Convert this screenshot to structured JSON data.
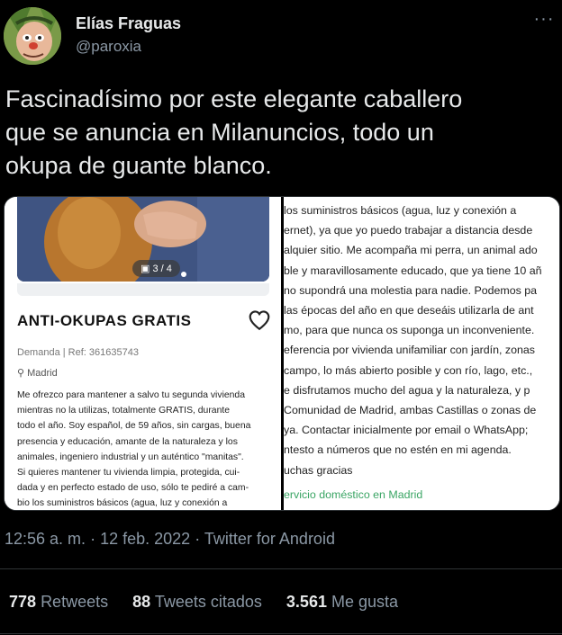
{
  "author": {
    "name": "Elías Fraguas",
    "handle": "@paroxia"
  },
  "more_menu_icon": "ellipsis-icon",
  "tweet": {
    "text_lines": [
      "Fascinadísimo por este elegante caballero",
      "que se anuncia en Milanuncios, todo un",
      "okupa de guante blanco."
    ]
  },
  "ad": {
    "photo_counter": "3 / 4",
    "title": "ANTI-OKUPAS GRATIS",
    "ref": "Demanda | Ref: 361635743",
    "location": "Madrid",
    "body_lines": [
      "Me ofrezco para mantener a salvo tu segunda vivienda",
      "mientras no la utilizas, totalmente GRATIS, durante",
      "todo el año. Soy español, de 59 años, sin cargas, buena",
      "presencia y educación, amante de la naturaleza y los",
      "animales, ingeniero industrial y un auténtico \"manitas\".",
      "Si quieres mantener tu vivienda limpia, protegida, cui-",
      "dada y en perfecto estado de uso, sólo te pediré a cam-",
      "bio los suministros básicos (agua, luz y conexión a"
    ],
    "continued_lines": [
      " los suministros básicos (agua, luz y conexión a",
      "ernet), ya que yo puedo trabajar a distancia desde",
      "alquier sitio. Me acompaña mi perra, un animal ado",
      "ble y maravillosamente educado, que ya tiene 10 añ",
      "no supondrá una molestia para nadie. Podemos pa",
      " las épocas del año en que deseáis utilizarla de ant",
      "mo, para que nunca os suponga un inconveniente.",
      "eferencia por vivienda unifamiliar con jardín, zonas",
      " campo, lo más abierto posible y con río, lago, etc.,",
      "e disfrutamos mucho del agua y la naturaleza, y p",
      "Comunidad de Madrid, ambas Castillas  o zonas de",
      " ya. Contactar inicialmente por email o WhatsApp;",
      "ntesto a números que no estén en mi agenda.",
      "uchas gracias"
    ],
    "category_link": "ervicio doméstico en Madrid"
  },
  "meta": {
    "time": "12:56 a. m.",
    "separator": "·",
    "date": "12 feb. 2022",
    "source": "Twitter for Android"
  },
  "stats": {
    "retweets_count": "778",
    "retweets_label": "Retweets",
    "quotes_count": "88",
    "quotes_label": "Tweets citados",
    "likes_count": "3.561",
    "likes_label": "Me gusta"
  },
  "colors": {
    "background": "#000000",
    "text_primary": "#e7e9ea",
    "text_secondary": "#8b98a5",
    "divider": "#2f3336",
    "link_green": "#3aa564"
  }
}
